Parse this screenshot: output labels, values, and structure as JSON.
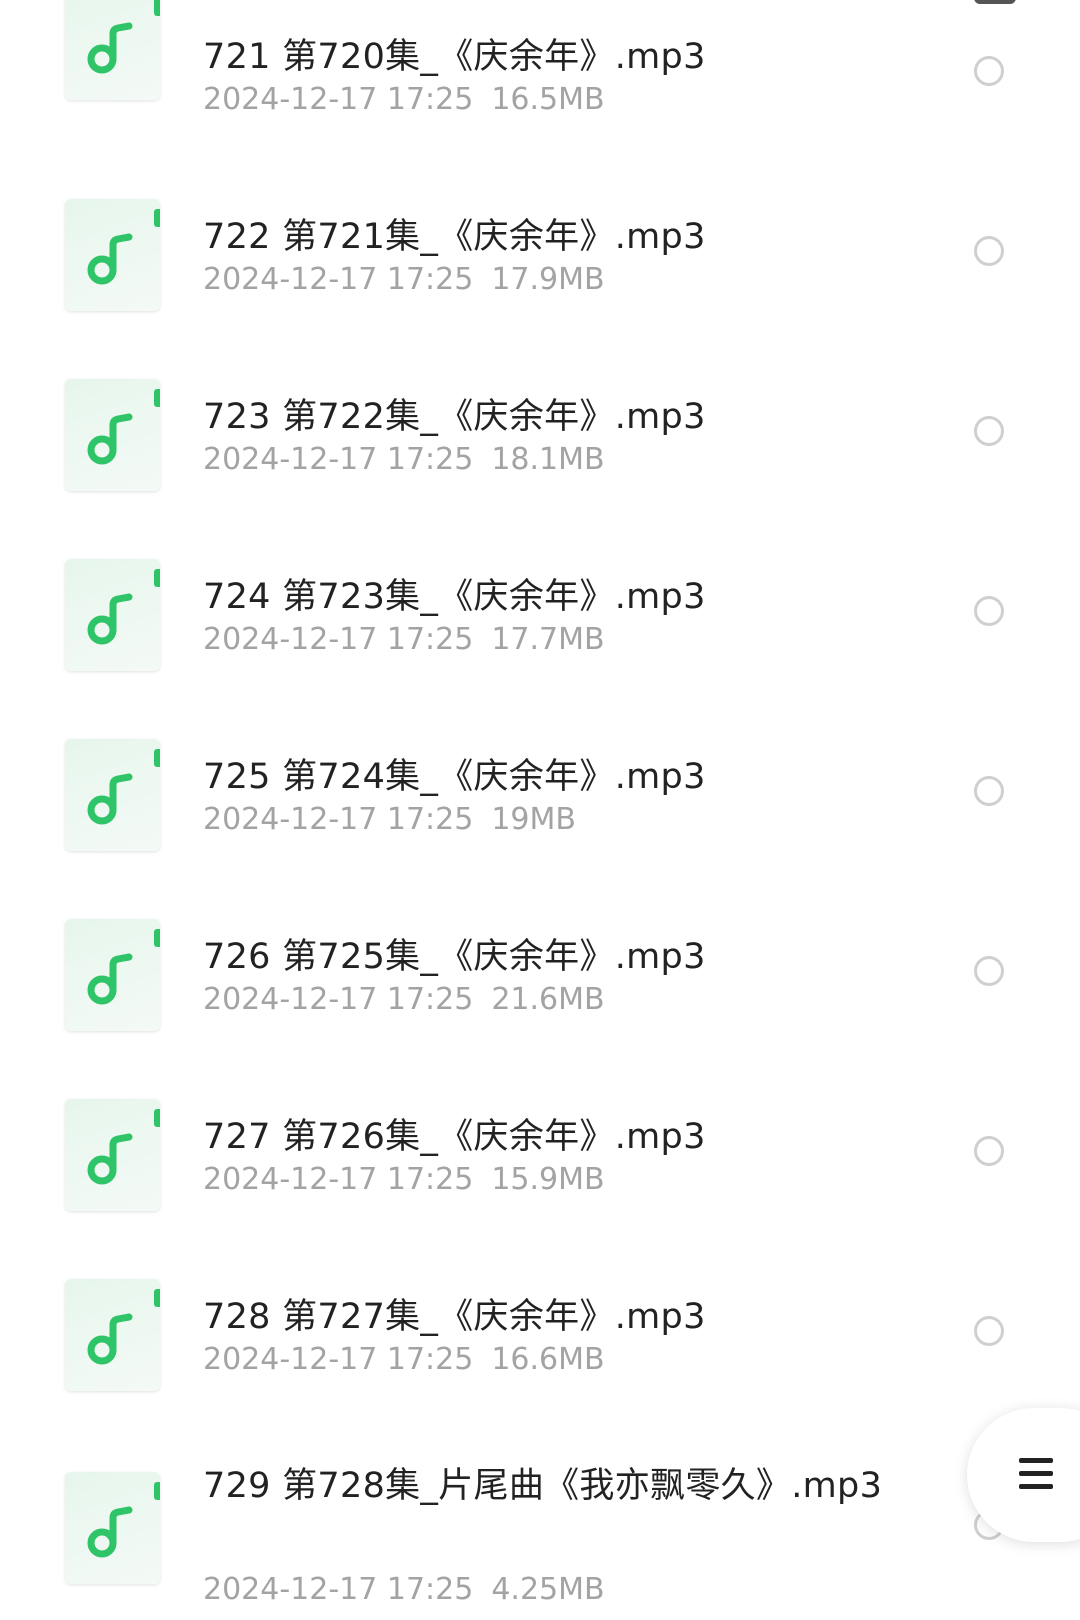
{
  "files": [
    {
      "name": "721 第720集_《庆余年》.mp3",
      "date": "2024-12-17 17:25",
      "size": "16.5MB"
    },
    {
      "name": "722 第721集_《庆余年》.mp3",
      "date": "2024-12-17 17:25",
      "size": "17.9MB"
    },
    {
      "name": "723 第722集_《庆余年》.mp3",
      "date": "2024-12-17 17:25",
      "size": "18.1MB"
    },
    {
      "name": "724 第723集_《庆余年》.mp3",
      "date": "2024-12-17 17:25",
      "size": "17.7MB"
    },
    {
      "name": "725 第724集_《庆余年》.mp3",
      "date": "2024-12-17 17:25",
      "size": "19MB"
    },
    {
      "name": "726 第725集_《庆余年》.mp3",
      "date": "2024-12-17 17:25",
      "size": "21.6MB"
    },
    {
      "name": "727 第726集_《庆余年》.mp3",
      "date": "2024-12-17 17:25",
      "size": "15.9MB"
    },
    {
      "name": "728 第727集_《庆余年》.mp3",
      "date": "2024-12-17 17:25",
      "size": "16.6MB"
    },
    {
      "name": "729 第728集_片尾曲《我亦飘零久》.mp3",
      "date": "2024-12-17 17:25",
      "size": "4.25MB"
    }
  ],
  "icons": {
    "file_type": "music-note-icon",
    "select": "radio-circle-icon",
    "fab": "menu-icon"
  },
  "colors": {
    "accent": "#2fc468",
    "title": "#222222",
    "meta": "#a3a3a3",
    "radio_border": "#cfcfcf"
  }
}
